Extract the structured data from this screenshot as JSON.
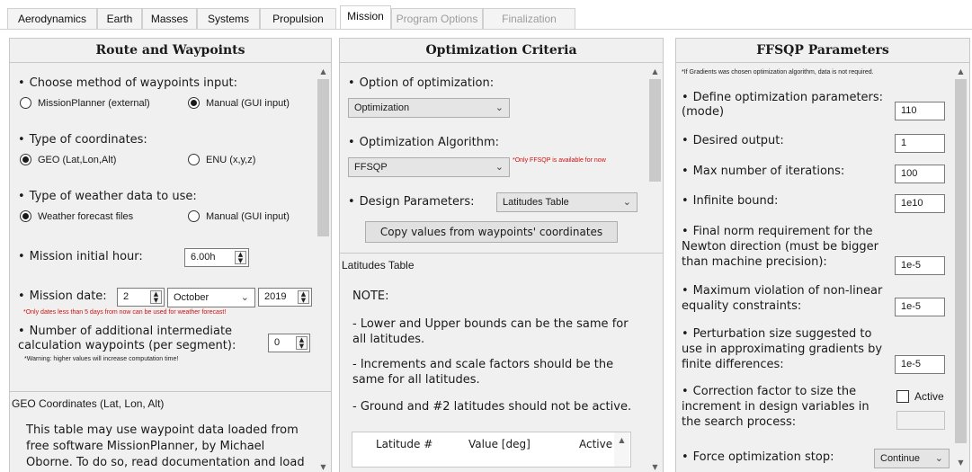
{
  "tabs": [
    {
      "label": "Aerodynamics",
      "state": "normal"
    },
    {
      "label": "Earth",
      "state": "normal"
    },
    {
      "label": "Masses",
      "state": "normal"
    },
    {
      "label": "Systems",
      "state": "normal"
    },
    {
      "label": "Propulsion",
      "state": "normal"
    },
    {
      "label": "Mission",
      "state": "active"
    },
    {
      "label": "Program Options",
      "state": "disabled"
    },
    {
      "label": "Finalization",
      "state": "disabled"
    }
  ],
  "route": {
    "title": "Route and Waypoints",
    "waypoints_method_label": "Choose method of waypoints input:",
    "waypoints_opt_external": "MissionPlanner (external)",
    "waypoints_opt_manual": "Manual (GUI input)",
    "coords_label": "Type of coordinates:",
    "coords_opt_geo": "GEO (Lat,Lon,Alt)",
    "coords_opt_enu": "ENU (x,y,z)",
    "weather_label": "Type of weather data to use:",
    "weather_opt_files": "Weather forecast files",
    "weather_opt_manual": "Manual (GUI input)",
    "initial_hour_label": "Mission initial hour:",
    "initial_hour_value": "6.00h",
    "date_label": "Mission date:",
    "date_day": "2",
    "date_month": "October",
    "date_year": "2019",
    "date_note": "*Only dates less than 5 days from now can be used for weather forecast!",
    "intermediate_label": "Number of additional intermediate calculation waypoints (per segment):",
    "intermediate_value": "0",
    "intermediate_warning": "*Warning: higher values will increase computation time!",
    "geo_title": "GEO Coordinates (Lat, Lon, Alt)",
    "geo_text": "This table may use waypoint data loaded from free software MissionPlanner, by Michael Oborne. To do so, read documentation and load"
  },
  "optimization": {
    "title": "Optimization Criteria",
    "option_label": "Option of optimization:",
    "option_value": "Optimization",
    "algorithm_label": "Optimization Algorithm:",
    "algorithm_value": "FFSQP",
    "algorithm_note": "*Only FFSQP is available for now",
    "design_label": "Design Parameters:",
    "design_value": "Latitudes Table",
    "copy_button": "Copy values from waypoints' coordinates",
    "latitudes_title": "Latitudes Table",
    "note_title": "NOTE:",
    "note_1": "- Lower and Upper bounds can be the same for all latitudes.",
    "note_2": "- Increments and scale factors should be the same for all latitudes.",
    "note_3": "- Ground and #2 latitudes should not be active.",
    "table_headers": [
      "Latitude #",
      "Value [deg]",
      "Active"
    ]
  },
  "ffsqp": {
    "title": "FFSQP Parameters",
    "note": "*If Gradients was chosen optimization algorithm, data is not required.",
    "params": [
      {
        "label": "Define optimization parameters: (mode)",
        "value": "110"
      },
      {
        "label": "Desired output:",
        "value": "1"
      },
      {
        "label": "Max number of iterations:",
        "value": "100"
      },
      {
        "label": "Infinite bound:",
        "value": "1e10"
      },
      {
        "label": "Final norm requirement for the Newton direction (must be bigger than machine precision):",
        "value": "1e-5"
      },
      {
        "label": "Maximum violation of non-linear equality constraints:",
        "value": "1e-5"
      },
      {
        "label": "Perturbation size suggested to use in approximating gradients by finite differences:",
        "value": "1e-5"
      }
    ],
    "correction_label": "Correction factor to size the increment in design variables in the search process:",
    "correction_check": "Active",
    "force_stop_label": "Force optimization stop:",
    "force_stop_value": "Continue"
  }
}
